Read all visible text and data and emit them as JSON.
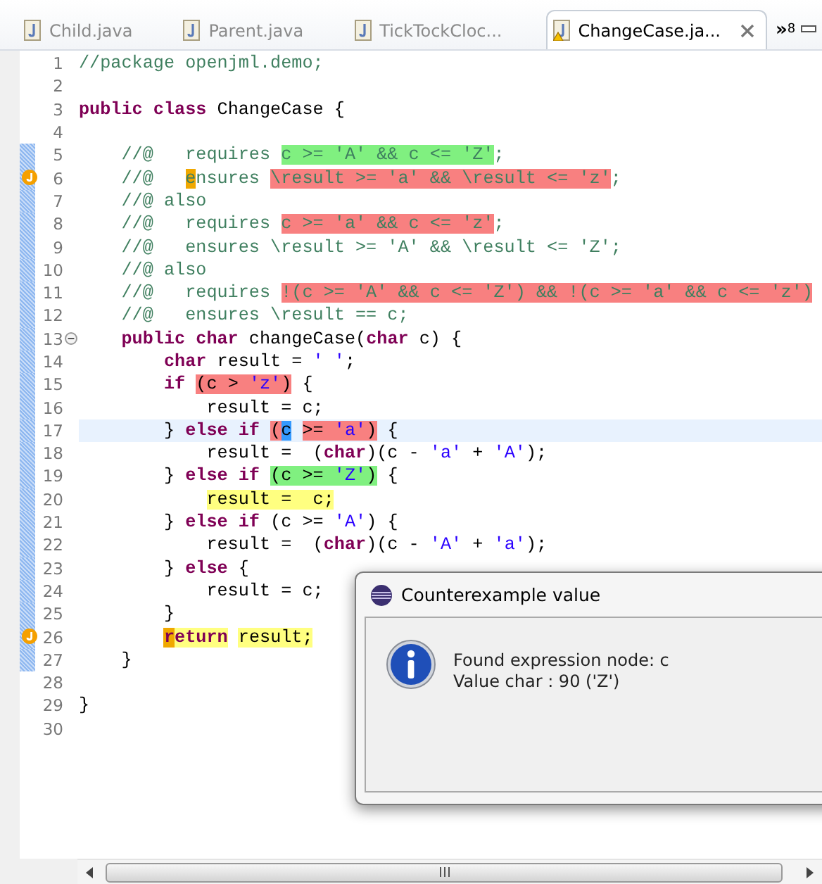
{
  "tabs": [
    {
      "label": "Child.java",
      "selected": false,
      "warning": false
    },
    {
      "label": "Parent.java",
      "selected": false,
      "warning": false
    },
    {
      "label": "TickTockCloc...",
      "selected": false,
      "warning": false
    },
    {
      "label": "ChangeCase.ja...",
      "selected": true,
      "warning": true
    }
  ],
  "tab_overflow": {
    "symbol": "»",
    "count": "8"
  },
  "lines": [
    {
      "number": "1",
      "kind": "plain",
      "current": false,
      "annotated": false,
      "segments": [
        {
          "text": "//package openjml.demo;",
          "kind": "comment"
        }
      ]
    },
    {
      "number": "2",
      "kind": "plain",
      "current": false,
      "annotated": false
    },
    {
      "number": "3",
      "kind": "plain",
      "current": false,
      "annotated": false,
      "segments": [
        {
          "text": "public class",
          "kind": "keyword"
        },
        {
          "text": " ChangeCase {",
          "kind": "plain"
        }
      ]
    },
    {
      "number": "4",
      "kind": "plain",
      "current": false,
      "annotated": false
    },
    {
      "number": "5",
      "kind": "plain",
      "current": false,
      "annotated": true,
      "segments": [
        {
          "text": "    //@   requires ",
          "kind": "comment"
        },
        {
          "text": "c >= 'A' && c <= 'Z'",
          "kind": "comment",
          "color": "#80f080"
        },
        {
          "text": ";",
          "kind": "comment"
        }
      ]
    },
    {
      "number": "6",
      "kind": "warning",
      "current": false,
      "annotated": true,
      "segments": [
        {
          "text": "    //@   ",
          "kind": "comment"
        },
        {
          "text": "e",
          "kind": "comment",
          "color": "#f0a800"
        },
        {
          "text": "nsures ",
          "kind": "comment"
        },
        {
          "text": "\\result >= 'a' && \\result <= 'z'",
          "kind": "comment",
          "color": "#f88080"
        },
        {
          "text": ";",
          "kind": "comment"
        }
      ]
    },
    {
      "number": "7",
      "kind": "plain",
      "current": false,
      "annotated": true,
      "segments": [
        {
          "text": "    //@ also",
          "kind": "comment"
        }
      ]
    },
    {
      "number": "8",
      "kind": "plain",
      "current": false,
      "annotated": true,
      "segments": [
        {
          "text": "    //@   requires ",
          "kind": "comment"
        },
        {
          "text": "c >= 'a' && c <= 'z'",
          "kind": "comment",
          "color": "#f88080"
        },
        {
          "text": ";",
          "kind": "comment"
        }
      ]
    },
    {
      "number": "9",
      "kind": "plain",
      "current": false,
      "annotated": true,
      "segments": [
        {
          "text": "    //@   ensures \\result >= 'A' && \\result <= 'Z';",
          "kind": "comment"
        }
      ]
    },
    {
      "number": "10",
      "kind": "plain",
      "current": false,
      "annotated": true,
      "segments": [
        {
          "text": "    //@ also",
          "kind": "comment"
        }
      ]
    },
    {
      "number": "11",
      "kind": "plain",
      "current": false,
      "annotated": true,
      "segments": [
        {
          "text": "    //@   requires ",
          "kind": "comment"
        },
        {
          "text": "!(c >= 'A' && c <= 'Z') && !(c >= 'a' && c <= 'z')",
          "kind": "comment",
          "color": "#f88080"
        }
      ]
    },
    {
      "number": "12",
      "kind": "plain",
      "current": false,
      "annotated": true,
      "segments": [
        {
          "text": "    //@   ensures \\result == c;",
          "kind": "comment"
        }
      ]
    },
    {
      "number": "13",
      "kind": "fold",
      "current": false,
      "annotated": true,
      "segments": [
        {
          "text": "    public char",
          "kind": "keyword"
        },
        {
          "text": " changeCase(",
          "kind": "plain"
        },
        {
          "text": "char",
          "kind": "keyword"
        },
        {
          "text": " c) {",
          "kind": "plain"
        }
      ]
    },
    {
      "number": "14",
      "kind": "plain",
      "current": false,
      "annotated": true,
      "segments": [
        {
          "text": "        char",
          "kind": "keyword"
        },
        {
          "text": " result = ",
          "kind": "plain"
        },
        {
          "text": "' '",
          "kind": "string"
        },
        {
          "text": ";",
          "kind": "plain"
        }
      ]
    },
    {
      "number": "15",
      "kind": "plain",
      "current": false,
      "annotated": true,
      "segments": [
        {
          "text": "        if ",
          "kind": "keyword"
        },
        {
          "text": "(c > ",
          "kind": "plain",
          "color": "#f88080"
        },
        {
          "text": "'z'",
          "kind": "string",
          "color": "#f88080"
        },
        {
          "text": ")",
          "kind": "plain",
          "color": "#f88080"
        },
        {
          "text": " {",
          "kind": "plain"
        }
      ]
    },
    {
      "number": "16",
      "kind": "plain",
      "current": false,
      "annotated": true,
      "segments": [
        {
          "text": "            result = c;",
          "kind": "plain"
        }
      ]
    },
    {
      "number": "17",
      "kind": "plain",
      "current": true,
      "annotated": true,
      "segments": [
        {
          "text": "        } ",
          "kind": "plain"
        },
        {
          "text": "else if ",
          "kind": "keyword"
        },
        {
          "text": "(",
          "kind": "plain",
          "color": "#f88080"
        },
        {
          "text": "c",
          "kind": "plain",
          "color": "#3399ff"
        },
        {
          "text": " >= ",
          "kind": "plain",
          "color": "#f88080"
        },
        {
          "text": "'a'",
          "kind": "string",
          "color": "#f88080"
        },
        {
          "text": ")",
          "kind": "plain",
          "color": "#f88080"
        },
        {
          "text": " {",
          "kind": "plain"
        }
      ]
    },
    {
      "number": "18",
      "kind": "plain",
      "current": false,
      "annotated": true,
      "segments": [
        {
          "text": "            result =  (",
          "kind": "plain"
        },
        {
          "text": "char",
          "kind": "keyword"
        },
        {
          "text": ")(c - ",
          "kind": "plain"
        },
        {
          "text": "'a'",
          "kind": "string"
        },
        {
          "text": " + ",
          "kind": "plain"
        },
        {
          "text": "'A'",
          "kind": "string"
        },
        {
          "text": ");",
          "kind": "plain"
        }
      ]
    },
    {
      "number": "19",
      "kind": "plain",
      "current": false,
      "annotated": true,
      "segments": [
        {
          "text": "        } ",
          "kind": "plain"
        },
        {
          "text": "else if ",
          "kind": "keyword"
        },
        {
          "text": "(c >= ",
          "kind": "plain",
          "color": "#80f080"
        },
        {
          "text": "'Z'",
          "kind": "string",
          "color": "#80f080"
        },
        {
          "text": ")",
          "kind": "plain",
          "color": "#80f080"
        },
        {
          "text": " {",
          "kind": "plain"
        }
      ]
    },
    {
      "number": "20",
      "kind": "plain",
      "current": false,
      "annotated": true,
      "segments": [
        {
          "text": "            result =  c;",
          "kind": "plain",
          "color": "#ffff80"
        }
      ]
    },
    {
      "number": "21",
      "kind": "plain",
      "current": false,
      "annotated": true,
      "segments": [
        {
          "text": "        } ",
          "kind": "plain"
        },
        {
          "text": "else if",
          "kind": "keyword"
        },
        {
          "text": " (c >= ",
          "kind": "plain"
        },
        {
          "text": "'A'",
          "kind": "string"
        },
        {
          "text": ") {",
          "kind": "plain"
        }
      ]
    },
    {
      "number": "22",
      "kind": "plain",
      "current": false,
      "annotated": true,
      "segments": [
        {
          "text": "            result =  (",
          "kind": "plain"
        },
        {
          "text": "char",
          "kind": "keyword"
        },
        {
          "text": ")(c - ",
          "kind": "plain"
        },
        {
          "text": "'A'",
          "kind": "string"
        },
        {
          "text": " + ",
          "kind": "plain"
        },
        {
          "text": "'a'",
          "kind": "string"
        },
        {
          "text": ");",
          "kind": "plain"
        }
      ]
    },
    {
      "number": "23",
      "kind": "plain",
      "current": false,
      "annotated": true,
      "segments": [
        {
          "text": "        } ",
          "kind": "plain"
        },
        {
          "text": "else",
          "kind": "keyword"
        },
        {
          "text": " {",
          "kind": "plain"
        }
      ]
    },
    {
      "number": "24",
      "kind": "plain",
      "current": false,
      "annotated": true,
      "segments": [
        {
          "text": "            result = c;",
          "kind": "plain"
        }
      ]
    },
    {
      "number": "25",
      "kind": "plain",
      "current": false,
      "annotated": true,
      "segments": [
        {
          "text": "        }",
          "kind": "plain"
        }
      ]
    },
    {
      "number": "26",
      "kind": "warning",
      "current": false,
      "annotated": true,
      "segments": [
        {
          "text": "        r",
          "kind": "keyword",
          "color": "#f0a800"
        },
        {
          "text": "eturn",
          "kind": "keyword",
          "color": "#ffff80"
        },
        {
          "text": " result;",
          "kind": "plain",
          "color": "#ffff80"
        }
      ]
    },
    {
      "number": "27",
      "kind": "plain",
      "current": false,
      "annotated": true,
      "segments": [
        {
          "text": "    }",
          "kind": "plain"
        }
      ]
    },
    {
      "number": "28",
      "kind": "plain",
      "current": false,
      "annotated": false
    },
    {
      "number": "29",
      "kind": "plain",
      "current": false,
      "annotated": false,
      "segments": [
        {
          "text": "}",
          "kind": "plain"
        }
      ]
    },
    {
      "number": "30",
      "kind": "plain",
      "current": false,
      "annotated": false
    }
  ],
  "dialog": {
    "title": "Counterexample value",
    "messages": [
      "Found expression node: c",
      "Value char : 90 ('Z')"
    ]
  }
}
